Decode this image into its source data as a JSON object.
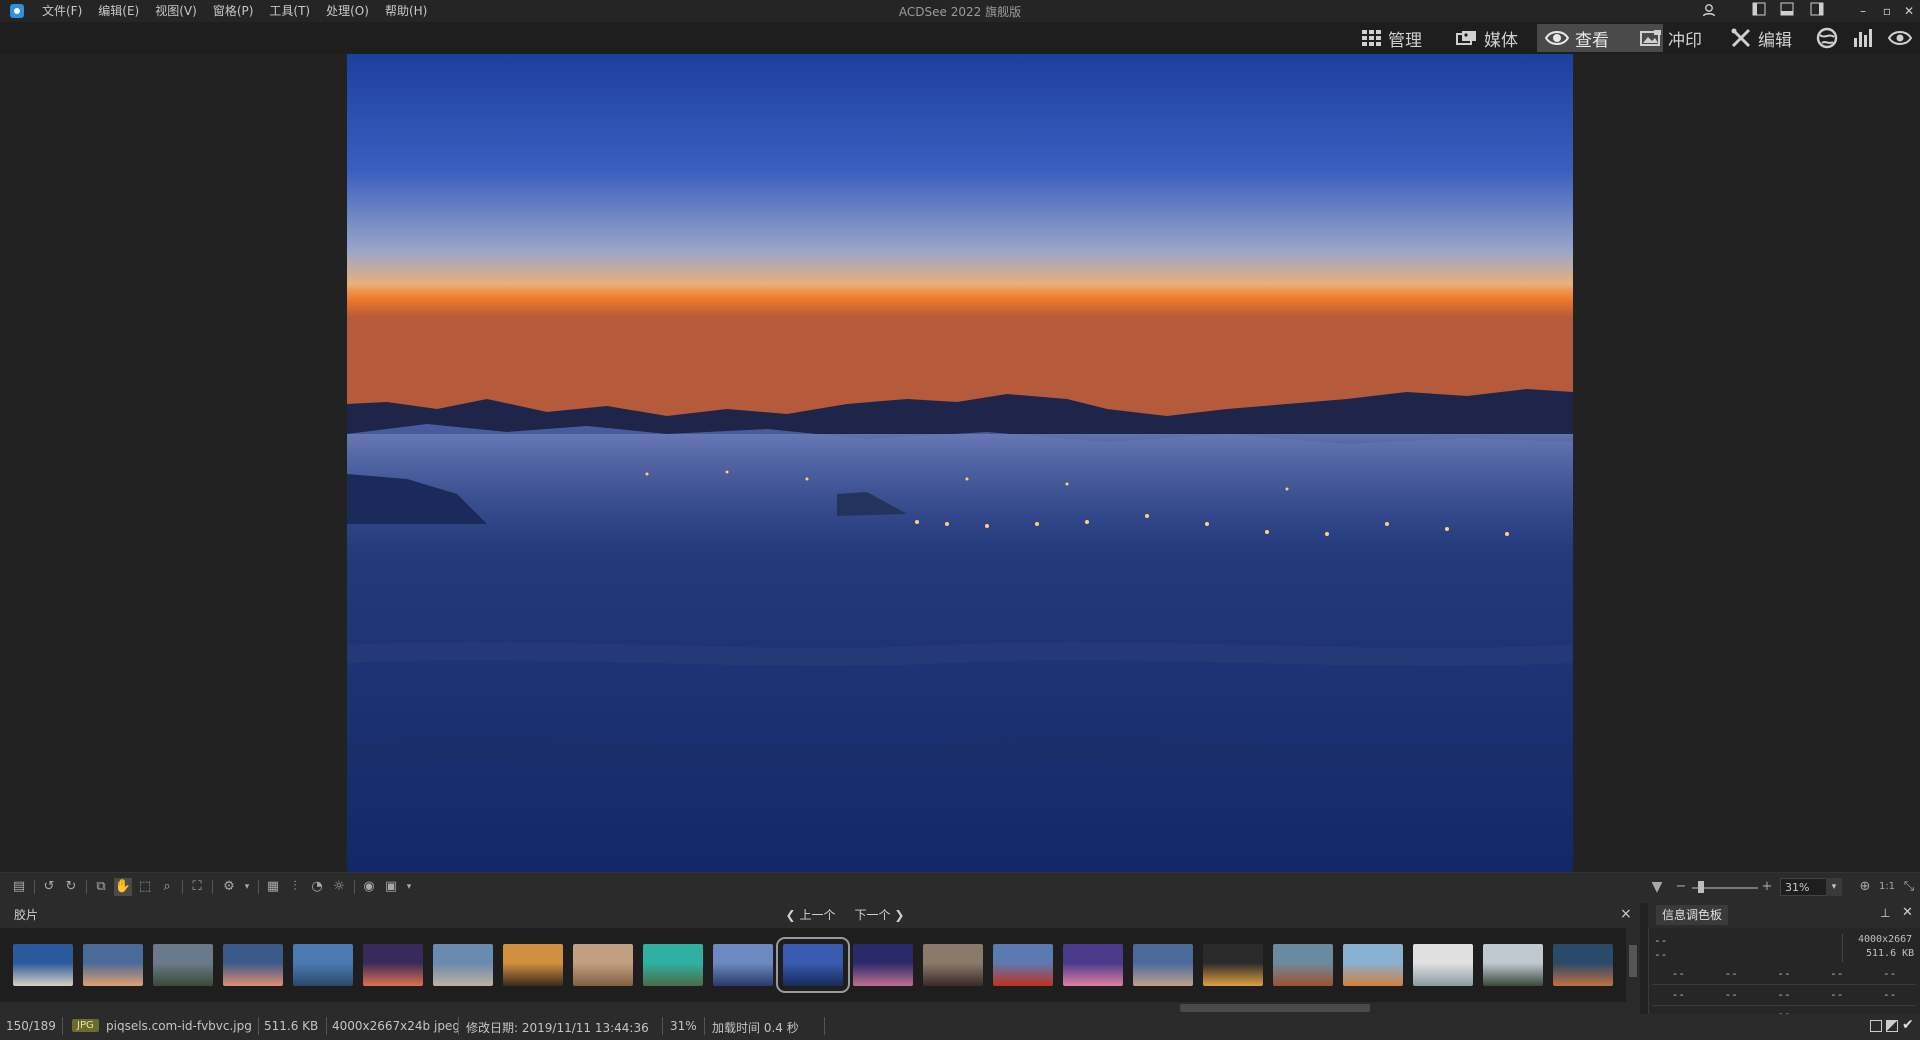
{
  "app": {
    "title": "ACDSee 2022 旗舰版"
  },
  "menu": [
    "文件(F)",
    "编辑(E)",
    "视图(V)",
    "窗格(P)",
    "工具(T)",
    "处理(O)",
    "帮助(H)"
  ],
  "modes": [
    {
      "label": "管理",
      "icon": "grid-icon",
      "active": false
    },
    {
      "label": "媒体",
      "icon": "media-icon",
      "active": false
    },
    {
      "label": "查看",
      "icon": "eye-icon",
      "active": true
    },
    {
      "label": "冲印",
      "icon": "develop-icon",
      "active": false
    },
    {
      "label": "编辑",
      "icon": "edit-icon",
      "active": false
    }
  ],
  "viewer_toolbar": {
    "zoom_value": "31%",
    "zoom_actual": "1:1"
  },
  "filmstrip": {
    "tab_label": "胶片",
    "prev_label": "上一个",
    "next_label": "下一个",
    "close_glyph": "×",
    "selected_index": 11,
    "thumb_count": 23
  },
  "info_panel": {
    "title": "信息调色板",
    "dimensions": "4000x2667",
    "file_size": "511.6 KB",
    "placeholder": "--"
  },
  "status": {
    "position": "150/189",
    "format_badge": "JPG",
    "filename": "piqsels.com-id-fvbvc.jpg",
    "size": "511.6 KB",
    "dims": "4000x2667x24b jpeg",
    "modified": "修改日期: 2019/11/11 13:44:36",
    "zoom": "31%",
    "load_time": "加载时间 0.4 秒"
  },
  "colors": {
    "background": "#222222",
    "active_mode": "#4a4a4a",
    "accent": "#2f8fe0"
  }
}
